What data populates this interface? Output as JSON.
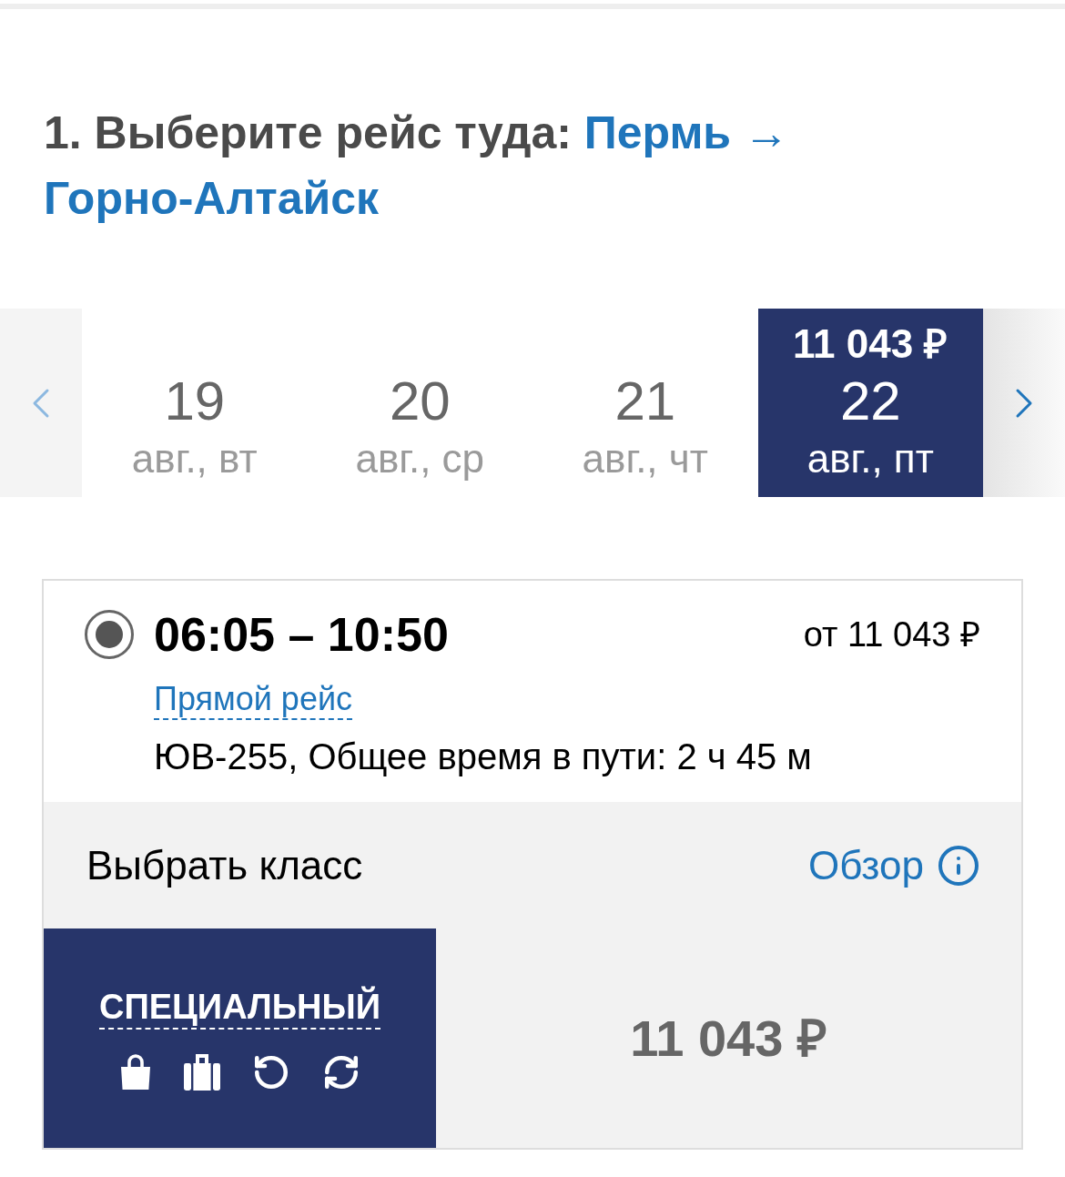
{
  "heading": {
    "prefix": "1. Выберите рейс туда:",
    "route": "Пермь → Горно-Алтайск"
  },
  "date_strip": {
    "prev_button": {
      "disabled": true
    },
    "next_button": {
      "disabled": false
    },
    "dates": [
      {
        "day": "19",
        "label": "авг., вт",
        "selected": false
      },
      {
        "day": "20",
        "label": "авг., ср",
        "selected": false
      },
      {
        "day": "21",
        "label": "авг., чт",
        "selected": false
      },
      {
        "price": "11 043 ₽",
        "day": "22",
        "label": "авг., пт",
        "selected": true
      }
    ]
  },
  "flight": {
    "selected": true,
    "times": "06:05 – 10:50",
    "price_from": "от 11 043 ₽",
    "type_link": "Прямой рейс",
    "details": "ЮВ-255, Общее время в пути: 2 ч 45 м"
  },
  "fare_section": {
    "title": "Выбрать класс",
    "overview_link": "Обзор",
    "fares": [
      {
        "name": "СПЕЦИАЛЬНЫЙ",
        "selected": true,
        "price": "11 043 ₽"
      }
    ]
  }
}
